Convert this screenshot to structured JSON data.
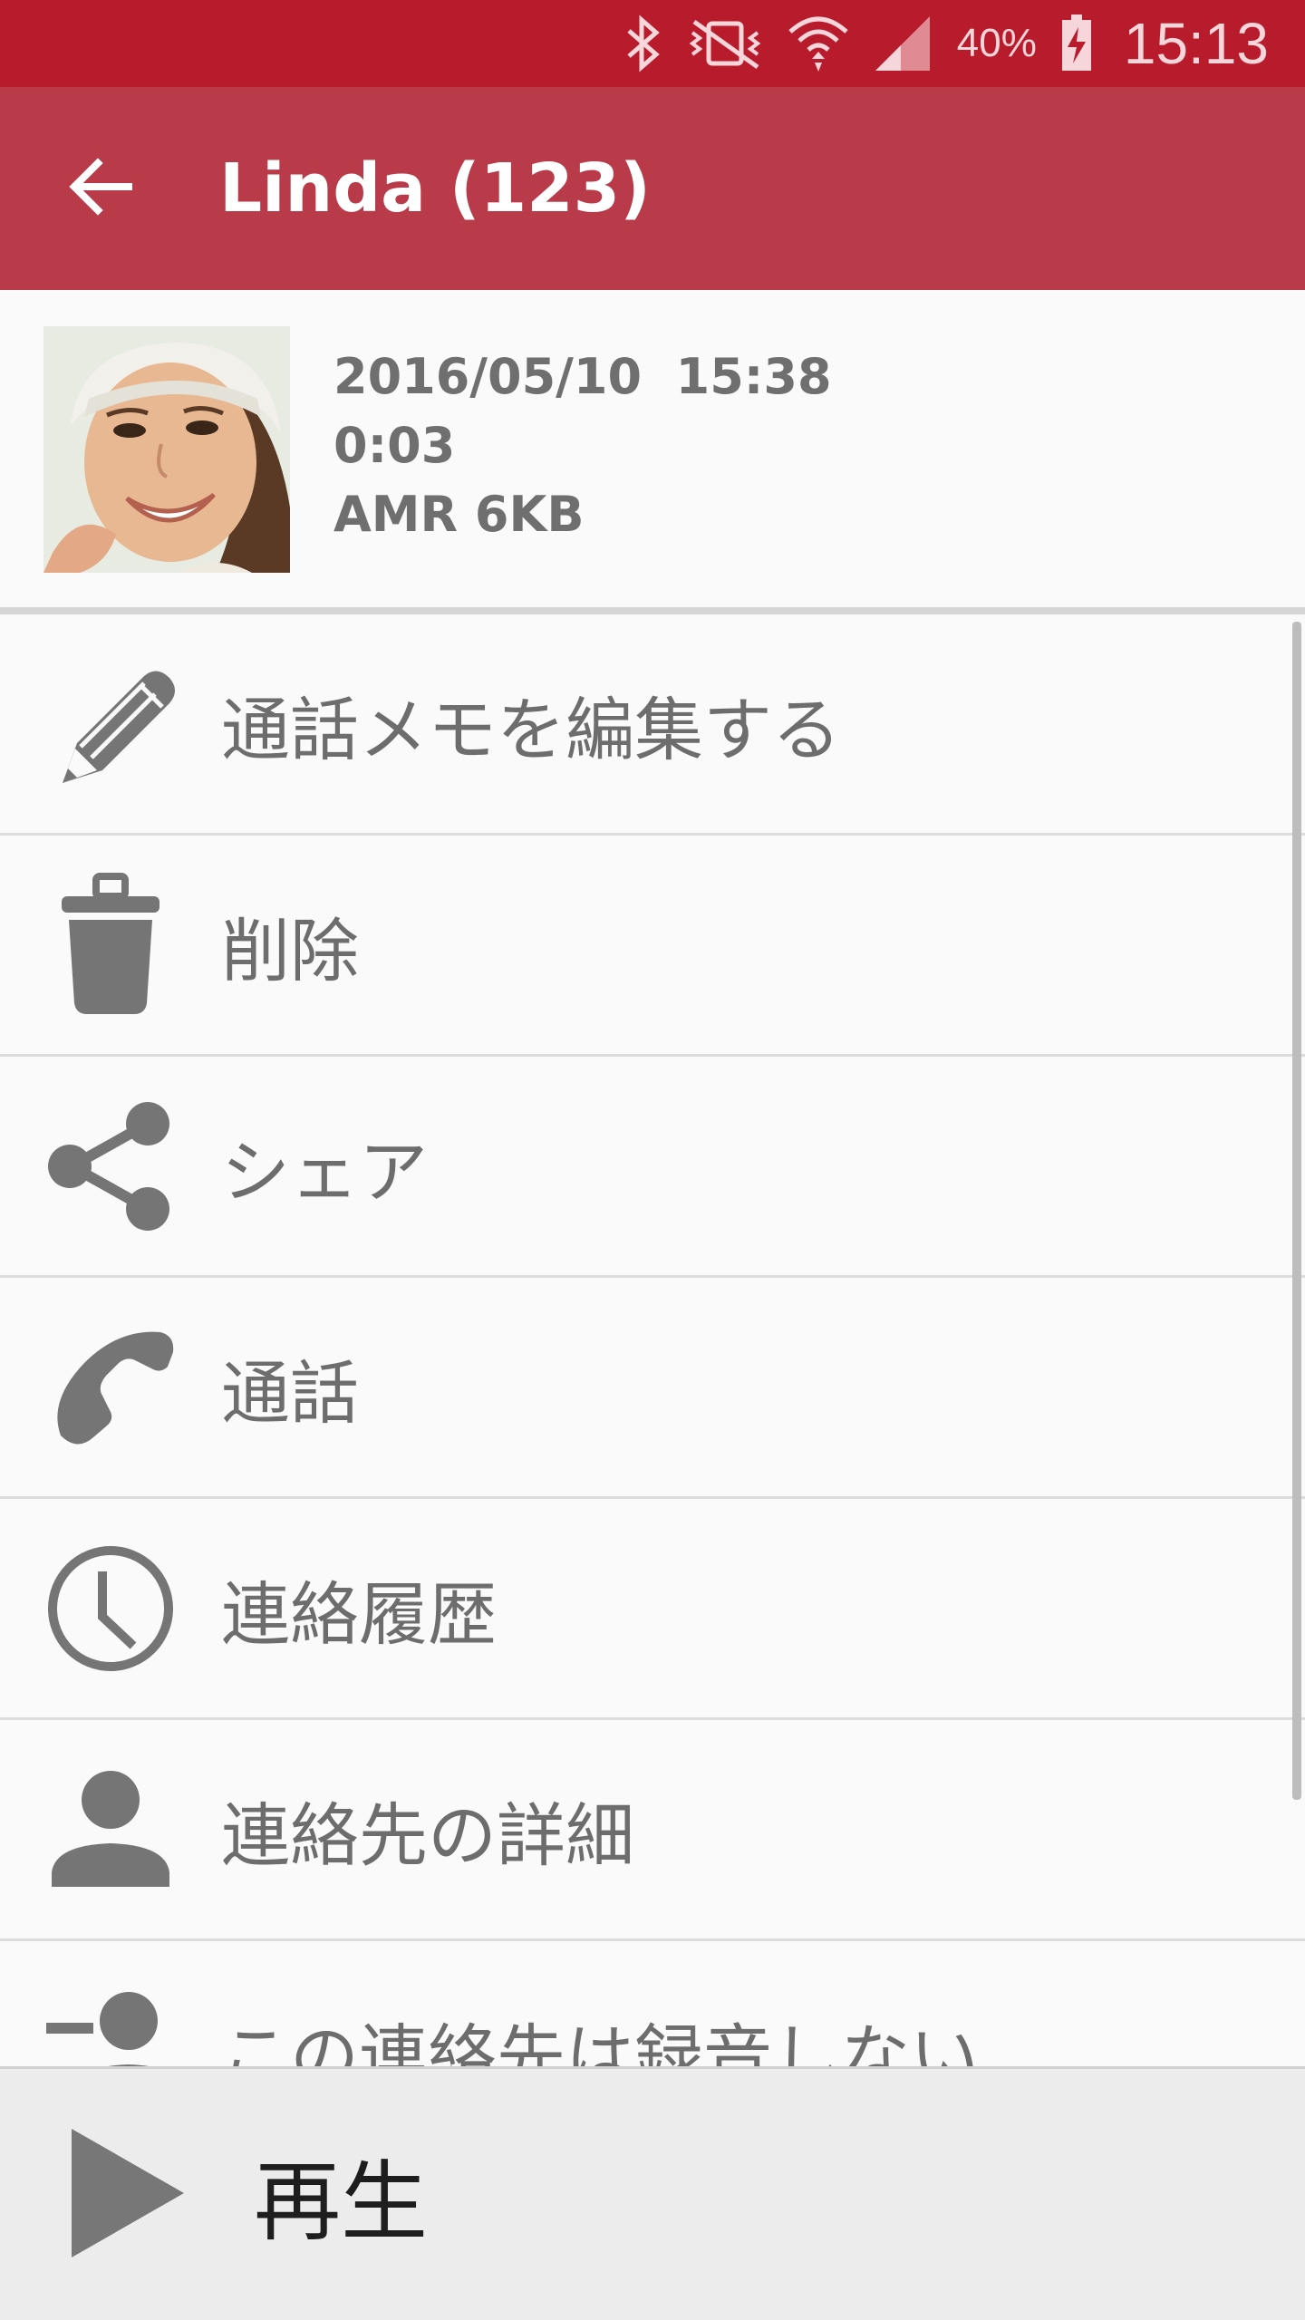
{
  "status_bar": {
    "battery_percent": "40%",
    "time": "15:13",
    "icons": [
      "bluetooth-icon",
      "vibrate-off-icon",
      "wifi-icon",
      "signal-icon",
      "battery-charging-icon"
    ]
  },
  "app_bar": {
    "back_icon": "arrow-back-icon",
    "title": "Linda (123)"
  },
  "recording": {
    "datetime": "2016/05/10  15:38",
    "duration": "0:03",
    "format": "AMR 6KB"
  },
  "menu": {
    "items": [
      {
        "icon": "pencil-icon",
        "label": "通話メモを編集する"
      },
      {
        "icon": "trash-icon",
        "label": "削除"
      },
      {
        "icon": "share-icon",
        "label": "シェア"
      },
      {
        "icon": "phone-icon",
        "label": "通話"
      },
      {
        "icon": "clock-icon",
        "label": "連絡履歴"
      },
      {
        "icon": "person-icon",
        "label": "連絡先の詳細"
      },
      {
        "icon": "person-remove-icon",
        "label": "この連絡先は録音しない"
      }
    ]
  },
  "player": {
    "icon": "play-icon",
    "label": "再生"
  },
  "colors": {
    "status_bar": "#b81c2c",
    "app_bar": "#b93a49",
    "icon_gray": "#757575"
  }
}
